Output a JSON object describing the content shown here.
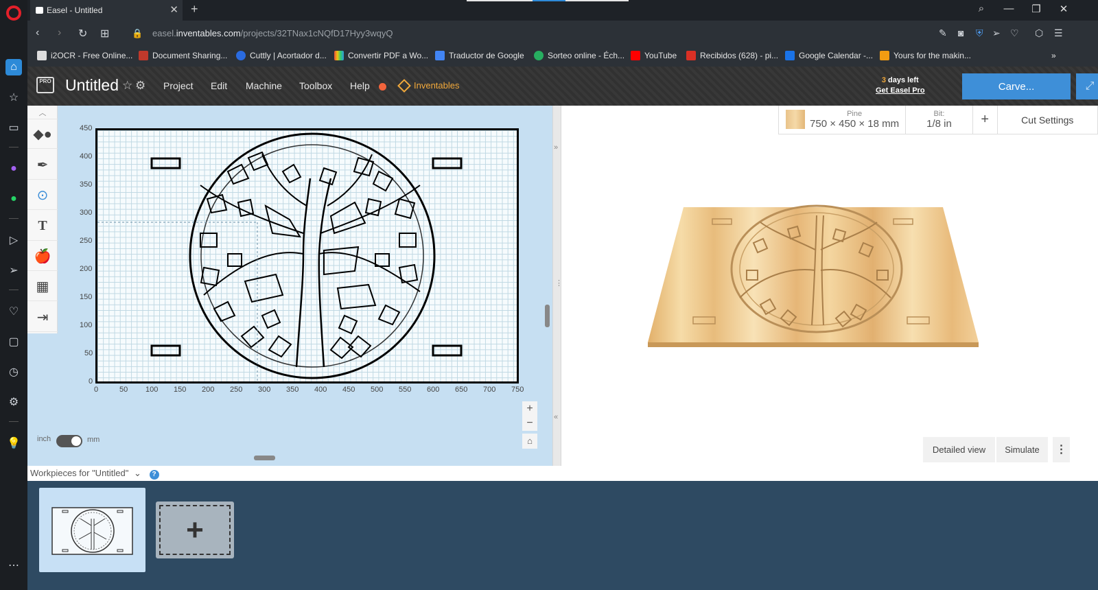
{
  "browser": {
    "tab_title": "Easel - Untitled",
    "url_prefix": "easel.",
    "url_domain": "inventables.com",
    "url_path": "/projects/32TNax1cNQfD17Hyy3wqyQ",
    "bookmarks": [
      "i2OCR - Free Online...",
      "Document Sharing...",
      "Cuttly | Acortador d...",
      "Convertir PDF a Wo...",
      "Traductor de Google",
      "Sorteo online - Éch...",
      "YouTube",
      "Recibidos (628) - pi...",
      "Google Calendar -...",
      "Yours for the makin..."
    ]
  },
  "header": {
    "logo": "PRO",
    "project_title": "Untitled",
    "menu": {
      "project": "Project",
      "edit": "Edit",
      "machine": "Machine",
      "toolbox": "Toolbox",
      "help": "Help"
    },
    "inventables": "Inventables",
    "trial_days_num": "3",
    "trial_days_text": " days left",
    "get_pro": "Get Easel Pro",
    "carve": "Carve...",
    "expand_icon": "expand-arrows-icon"
  },
  "canvas": {
    "x_ticks": [
      "0",
      "50",
      "100",
      "150",
      "200",
      "250",
      "300",
      "350",
      "400",
      "450",
      "500",
      "550",
      "600",
      "650",
      "700",
      "750"
    ],
    "y_ticks": [
      "450",
      "400",
      "350",
      "300",
      "250",
      "200",
      "150",
      "100",
      "50",
      "0"
    ],
    "unit_inch": "inch",
    "unit_mm": "mm",
    "unit_selected": "mm",
    "zoom_in": "+",
    "zoom_out": "−"
  },
  "material": {
    "name": "Pine",
    "dimensions": "750 × 450 × 18 mm",
    "bit_label": "Bit:",
    "bit_value": "1/8 in",
    "add": "+",
    "cut_settings": "Cut Settings"
  },
  "preview": {
    "detailed_view": "Detailed view",
    "simulate": "Simulate"
  },
  "workpieces": {
    "label": "Workpieces for \"Untitled\"",
    "help": "?"
  },
  "colors": {
    "accent_blue": "#3e8fd8",
    "inventables_orange": "#f2a93b",
    "help_dot": "#f2643c",
    "tray": "#2e4a62"
  }
}
